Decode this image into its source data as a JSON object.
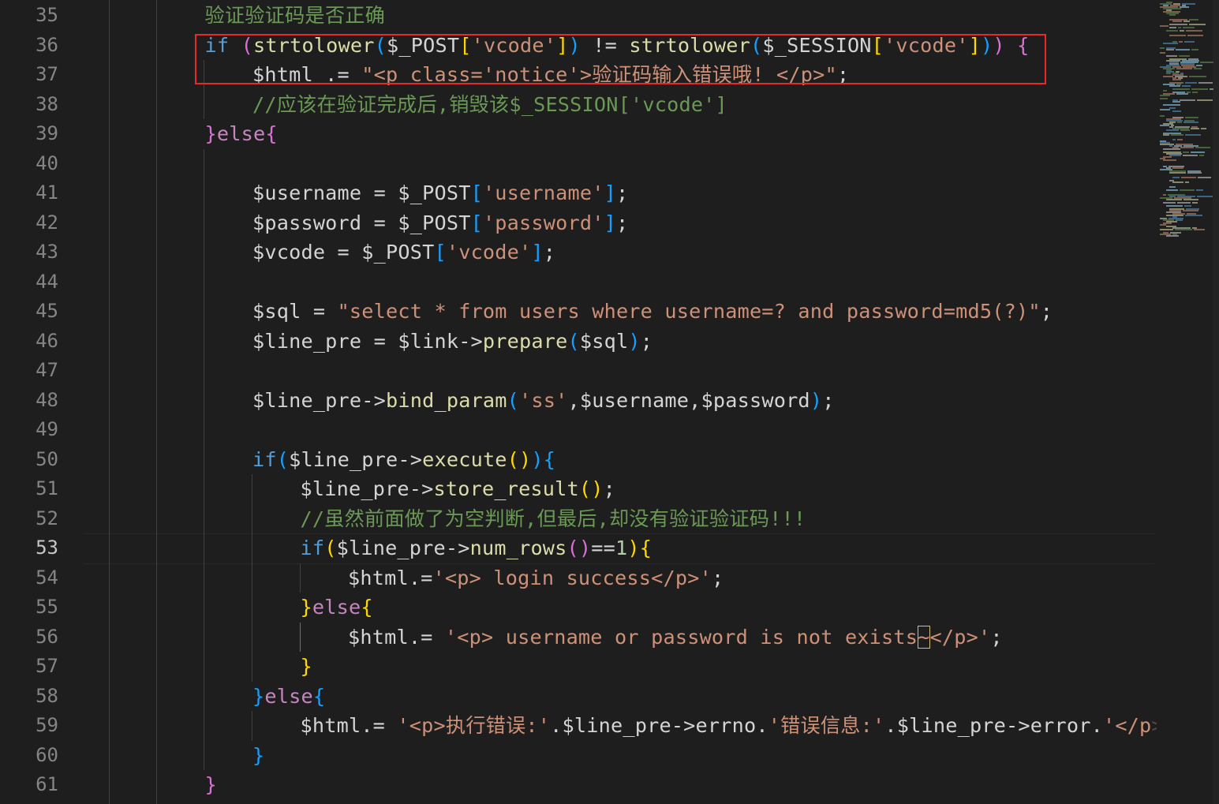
{
  "editor": {
    "current_line": "53",
    "lines": [
      {
        "n": "35",
        "indent": 3,
        "tokens": [
          {
            "c": "cm",
            "t": "验证验证码是否正确"
          }
        ]
      },
      {
        "n": "36",
        "indent": 3,
        "tokens": [
          {
            "c": "kw",
            "t": "if"
          },
          {
            "c": "var",
            "t": " "
          },
          {
            "c": "b2",
            "t": "("
          },
          {
            "c": "fn",
            "t": "strtolower"
          },
          {
            "c": "b3",
            "t": "("
          },
          {
            "c": "var",
            "t": "$_POST"
          },
          {
            "c": "b1",
            "t": "["
          },
          {
            "c": "str",
            "t": "'vcode'"
          },
          {
            "c": "b1",
            "t": "]"
          },
          {
            "c": "b3",
            "t": ")"
          },
          {
            "c": "var",
            "t": " != "
          },
          {
            "c": "fn",
            "t": "strtolower"
          },
          {
            "c": "b3",
            "t": "("
          },
          {
            "c": "var",
            "t": "$_SESSION"
          },
          {
            "c": "b1",
            "t": "["
          },
          {
            "c": "str",
            "t": "'vcode'"
          },
          {
            "c": "b1",
            "t": "]"
          },
          {
            "c": "b3",
            "t": ")"
          },
          {
            "c": "b2",
            "t": ")"
          },
          {
            "c": "var",
            "t": " "
          },
          {
            "c": "b2",
            "t": "{"
          }
        ]
      },
      {
        "n": "37",
        "indent": 4,
        "tokens": [
          {
            "c": "var",
            "t": "$html .= "
          },
          {
            "c": "str",
            "t": "\"<p class='notice'>验证码输入错误哦! </p>\""
          },
          {
            "c": "var",
            "t": ";"
          }
        ]
      },
      {
        "n": "38",
        "indent": 4,
        "tokens": [
          {
            "c": "cm",
            "t": "//应该在验证完成后,销毁该$_SESSION['vcode']"
          }
        ]
      },
      {
        "n": "39",
        "indent": 3,
        "tokens": [
          {
            "c": "b2",
            "t": "}"
          },
          {
            "c": "kwc",
            "t": "else"
          },
          {
            "c": "b2",
            "t": "{"
          }
        ]
      },
      {
        "n": "40",
        "indent": 3,
        "tokens": []
      },
      {
        "n": "41",
        "indent": 4,
        "tokens": [
          {
            "c": "var",
            "t": "$username = $_POST"
          },
          {
            "c": "b3",
            "t": "["
          },
          {
            "c": "str",
            "t": "'username'"
          },
          {
            "c": "b3",
            "t": "]"
          },
          {
            "c": "var",
            "t": ";"
          }
        ]
      },
      {
        "n": "42",
        "indent": 4,
        "tokens": [
          {
            "c": "var",
            "t": "$password = $_POST"
          },
          {
            "c": "b3",
            "t": "["
          },
          {
            "c": "str",
            "t": "'password'"
          },
          {
            "c": "b3",
            "t": "]"
          },
          {
            "c": "var",
            "t": ";"
          }
        ]
      },
      {
        "n": "43",
        "indent": 4,
        "tokens": [
          {
            "c": "var",
            "t": "$vcode = $_POST"
          },
          {
            "c": "b3",
            "t": "["
          },
          {
            "c": "str",
            "t": "'vcode'"
          },
          {
            "c": "b3",
            "t": "]"
          },
          {
            "c": "var",
            "t": ";"
          }
        ]
      },
      {
        "n": "44",
        "indent": 4,
        "tokens": []
      },
      {
        "n": "45",
        "indent": 4,
        "tokens": [
          {
            "c": "var",
            "t": "$sql = "
          },
          {
            "c": "str",
            "t": "\"select * from users where username=? and password=md5(?)\""
          },
          {
            "c": "var",
            "t": ";"
          }
        ]
      },
      {
        "n": "46",
        "indent": 4,
        "tokens": [
          {
            "c": "var",
            "t": "$line_pre = $link->"
          },
          {
            "c": "fn",
            "t": "prepare"
          },
          {
            "c": "b3",
            "t": "("
          },
          {
            "c": "var",
            "t": "$sql"
          },
          {
            "c": "b3",
            "t": ")"
          },
          {
            "c": "var",
            "t": ";"
          }
        ]
      },
      {
        "n": "47",
        "indent": 4,
        "tokens": []
      },
      {
        "n": "48",
        "indent": 4,
        "tokens": [
          {
            "c": "var",
            "t": "$line_pre->"
          },
          {
            "c": "fn",
            "t": "bind_param"
          },
          {
            "c": "b3",
            "t": "("
          },
          {
            "c": "str",
            "t": "'ss'"
          },
          {
            "c": "var",
            "t": ",$username,$password"
          },
          {
            "c": "b3",
            "t": ")"
          },
          {
            "c": "var",
            "t": ";"
          }
        ]
      },
      {
        "n": "49",
        "indent": 4,
        "tokens": []
      },
      {
        "n": "50",
        "indent": 4,
        "tokens": [
          {
            "c": "kw",
            "t": "if"
          },
          {
            "c": "b3",
            "t": "("
          },
          {
            "c": "var",
            "t": "$line_pre->"
          },
          {
            "c": "fn",
            "t": "execute"
          },
          {
            "c": "b1",
            "t": "()"
          },
          {
            "c": "b3",
            "t": ")"
          },
          {
            "c": "b3",
            "t": "{"
          }
        ]
      },
      {
        "n": "51",
        "indent": 5,
        "tokens": [
          {
            "c": "var",
            "t": "$line_pre->"
          },
          {
            "c": "fn",
            "t": "store_result"
          },
          {
            "c": "b1",
            "t": "()"
          },
          {
            "c": "var",
            "t": ";"
          }
        ]
      },
      {
        "n": "52",
        "indent": 5,
        "tokens": [
          {
            "c": "cm",
            "t": "//虽然前面做了为空判断,但最后,却没有验证验证码!!!"
          }
        ]
      },
      {
        "n": "53",
        "indent": 5,
        "tokens": [
          {
            "c": "kw",
            "t": "if"
          },
          {
            "c": "b1",
            "t": "("
          },
          {
            "c": "var",
            "t": "$line_pre->"
          },
          {
            "c": "fn",
            "t": "num_rows"
          },
          {
            "c": "b2",
            "t": "()"
          },
          {
            "c": "var",
            "t": "=="
          },
          {
            "c": "num",
            "t": "1"
          },
          {
            "c": "b1",
            "t": ")"
          },
          {
            "c": "b1",
            "t": "{"
          }
        ]
      },
      {
        "n": "54",
        "indent": 6,
        "tokens": [
          {
            "c": "var",
            "t": "$html.="
          },
          {
            "c": "str",
            "t": "'<p> login success</p>'"
          },
          {
            "c": "var",
            "t": ";"
          }
        ]
      },
      {
        "n": "55",
        "indent": 5,
        "tokens": [
          {
            "c": "b1",
            "t": "}"
          },
          {
            "c": "kwc",
            "t": "else"
          },
          {
            "c": "b1",
            "t": "{"
          }
        ]
      },
      {
        "n": "56",
        "indent": 6,
        "tokens": [
          {
            "c": "var",
            "t": "$html.= "
          },
          {
            "c": "str",
            "t": "'<p> username or password is not exists"
          },
          {
            "c": "str tilde-box",
            "t": "~"
          },
          {
            "c": "str",
            "t": "</p>'"
          },
          {
            "c": "var",
            "t": ";"
          }
        ]
      },
      {
        "n": "57",
        "indent": 5,
        "tokens": [
          {
            "c": "b1",
            "t": "}"
          }
        ]
      },
      {
        "n": "58",
        "indent": 4,
        "tokens": [
          {
            "c": "b3",
            "t": "}"
          },
          {
            "c": "kwc",
            "t": "else"
          },
          {
            "c": "b3",
            "t": "{"
          }
        ]
      },
      {
        "n": "59",
        "indent": 5,
        "tokens": [
          {
            "c": "var",
            "t": "$html.= "
          },
          {
            "c": "str",
            "t": "'<p>执行错误:'"
          },
          {
            "c": "var",
            "t": ".$line_pre->errno."
          },
          {
            "c": "str",
            "t": "'错误信息:'"
          },
          {
            "c": "var",
            "t": ".$line_pre->error."
          },
          {
            "c": "str",
            "t": "'</p"
          },
          {
            "c": "str fade",
            "t": ">';"
          }
        ]
      },
      {
        "n": "60",
        "indent": 4,
        "tokens": [
          {
            "c": "b3",
            "t": "}"
          }
        ]
      },
      {
        "n": "61",
        "indent": 3,
        "tokens": [
          {
            "c": "b2",
            "t": "}"
          }
        ]
      }
    ]
  },
  "colors": {
    "background": "#1e1e1e",
    "highlight_box": "#e62a2a",
    "keyword": "#569cd6",
    "control": "#c586c0",
    "function": "#dcdcaa",
    "string": "#ce9178",
    "comment": "#6a9955"
  }
}
